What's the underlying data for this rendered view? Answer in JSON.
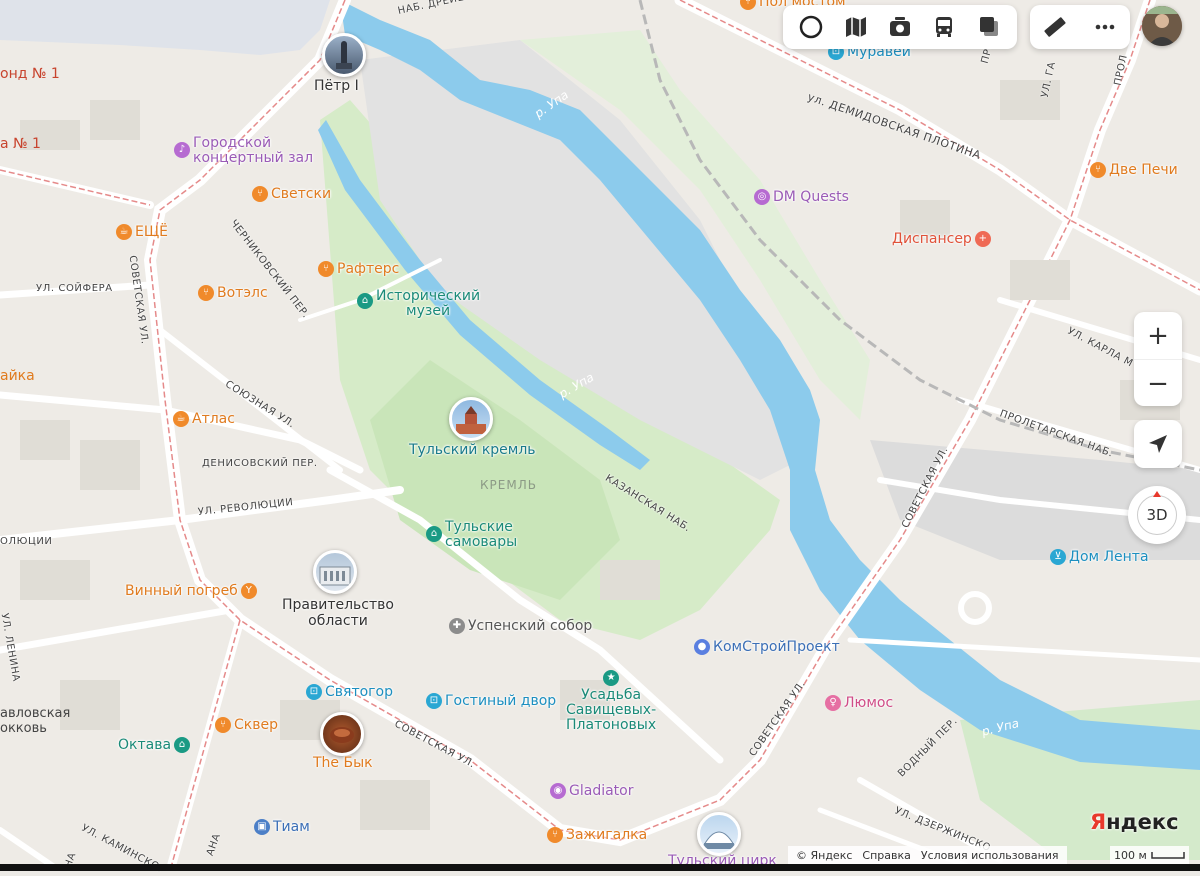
{
  "toolbar": {
    "buttons": [
      {
        "name": "layers-icon"
      },
      {
        "name": "map-mode-icon"
      },
      {
        "name": "panorama-icon"
      },
      {
        "name": "transport-icon"
      },
      {
        "name": "pages-icon"
      }
    ],
    "tools": [
      {
        "name": "ruler-icon"
      },
      {
        "name": "more-icon"
      }
    ]
  },
  "controls": {
    "zoom_in": "+",
    "zoom_out": "−",
    "three_d": "3D"
  },
  "footer": {
    "copyright": "© Яндекс",
    "help": "Справка",
    "terms": "Условия использования",
    "scale": "100 м"
  },
  "logo": {
    "first": "Я",
    "rest": "ндекс"
  },
  "colors": {
    "water": "#8ccbec",
    "park": "#cfe8c6",
    "road": "#ffffff",
    "tram": "#e58a8a",
    "food": "#f08a2b",
    "culture": "#1a9a84",
    "shop": "#2aa7d3",
    "entertainment": "#b66bd1"
  },
  "pins": [
    {
      "label": "Пётр I"
    },
    {
      "label": "Тульский кремль"
    },
    {
      "label": "Правительство\nобласти"
    },
    {
      "label": "The Бык"
    },
    {
      "label": "Тульский цирк"
    }
  ],
  "pois": [
    {
      "label": "Городской\nконцертный зал",
      "icon": "music-icon"
    },
    {
      "label": "Светски",
      "icon": "fork-icon"
    },
    {
      "label": "ЕЩЁ",
      "icon": "cafe-icon"
    },
    {
      "label": "Рафтерс",
      "icon": "fork-icon"
    },
    {
      "label": "Вотэлс",
      "icon": "fork-icon"
    },
    {
      "label": "Исторический\nмузей",
      "icon": "museum-icon"
    },
    {
      "label": "Атлас",
      "icon": "cafe-icon"
    },
    {
      "label": "Тульские\nсамовары",
      "icon": "museum-icon"
    },
    {
      "label": "Винный погреб",
      "icon": "bar-icon"
    },
    {
      "label": "Успенский собор",
      "icon": "church-icon"
    },
    {
      "label": "Святогор",
      "icon": "shop-icon"
    },
    {
      "label": "Гостиный двор",
      "icon": "shop-icon"
    },
    {
      "label": "Усадьба\nСавищевых-\nПлатоновых",
      "icon": "landmark-icon"
    },
    {
      "label": "Сквер",
      "icon": "fork-icon"
    },
    {
      "label": "Октава",
      "icon": "museum-icon"
    },
    {
      "label": "Gladiator",
      "icon": "gym-icon"
    },
    {
      "label": "Тиам",
      "icon": "briefcase-icon"
    },
    {
      "label": "Зажигалка",
      "icon": "fork-icon"
    },
    {
      "label": "КомСтройПроект",
      "icon": "office-icon"
    },
    {
      "label": "Люмос",
      "icon": "beauty-icon"
    },
    {
      "label": "DM Quests",
      "icon": "quest-icon"
    },
    {
      "label": "Две Печи",
      "icon": "fork-icon"
    },
    {
      "label": "Диспансер",
      "icon": "medical-icon"
    },
    {
      "label": "Дом Лента",
      "icon": "cart-icon"
    },
    {
      "label": "Муравей",
      "icon": "shop-icon"
    },
    {
      "label": "Пол мостом",
      "icon": "fork-icon"
    }
  ],
  "streets": [
    "ул. ДЕМИДОВСКАЯ ПЛОТИНА",
    "СОВЕТСКАЯ УЛ.",
    "СОВЕТСКАЯ УЛ.",
    "СОВЕТСКАЯ УЛ.",
    "СОВЕТСКАЯ УЛ.",
    "УЛ. СОЙФЕРА",
    "ЧЕРНИКОВСКИЙ ПЕР.",
    "СОЮЗНАЯ УЛ.",
    "ДЕНИСОВСКИЙ ПЕР.",
    "УЛ. РЕВОЛЮЦИИ",
    "КАЗАНСКАЯ НАБ.",
    "УЛ. КАРЛА М",
    "ПРОЛЕТАРСКАЯ НАБ.",
    "ВОДНЫЙ ПЕР.",
    "УЛ. ДЗЕРЖИНСКО",
    "УЛ. КАМИНСКОГ",
    "УЛ. ЛЕНИНА",
    "НАБ. ДРЕЙЕР",
    "ОЛЮЦИИ",
    "ПРО",
    "УЛ. ГА",
    "ПРОЛ",
    "АНА",
    "НА"
  ],
  "areas": [
    "КРЕМЛЬ",
    "онд № 1",
    "а № 1",
    "айка",
    "авловская\nокковь"
  ],
  "rivers": [
    "р. Упа",
    "р. Упа",
    "р. Упа"
  ]
}
